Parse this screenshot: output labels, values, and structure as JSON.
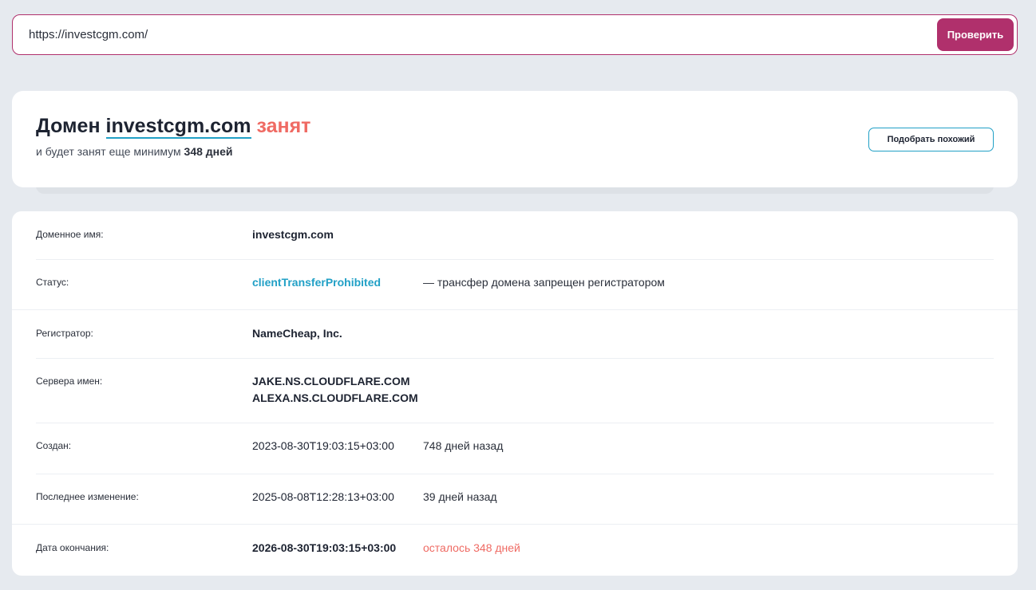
{
  "search": {
    "value": "https://investcgm.com/",
    "button_label": "Проверить"
  },
  "header": {
    "title_prefix": "Домен",
    "domain": "investcgm.com",
    "status_word": "занят",
    "subtitle_prefix": "и будет занят еще минимум",
    "subtitle_days": "348 дней",
    "similar_button": "Подобрать похожий"
  },
  "details": {
    "domain_label": "Доменное имя:",
    "domain_value": "investcgm.com",
    "status_label": "Статус:",
    "status_value": "clientTransferProhibited",
    "status_note": "— трансфер домена запрещен регистратором",
    "registrar_label": "Регистратор:",
    "registrar_value": "NameCheap, Inc.",
    "ns_label": "Сервера имен:",
    "ns_values": [
      "JAKE.NS.CLOUDFLARE.COM",
      "ALEXA.NS.CLOUDFLARE.COM"
    ],
    "created_label": "Создан:",
    "created_value": "2023-08-30T19:03:15+03:00",
    "created_note": "748 дней назад",
    "updated_label": "Последнее изменение:",
    "updated_value": "2025-08-08T12:28:13+03:00",
    "updated_note": "39 дней назад",
    "expires_label": "Дата окончания:",
    "expires_value": "2026-08-30T19:03:15+03:00",
    "expires_note": "осталось 348 дней"
  },
  "colors": {
    "accent": "#b0306c",
    "link": "#21a0c6",
    "busy": "#ef6a63",
    "background": "#e6eaef"
  }
}
